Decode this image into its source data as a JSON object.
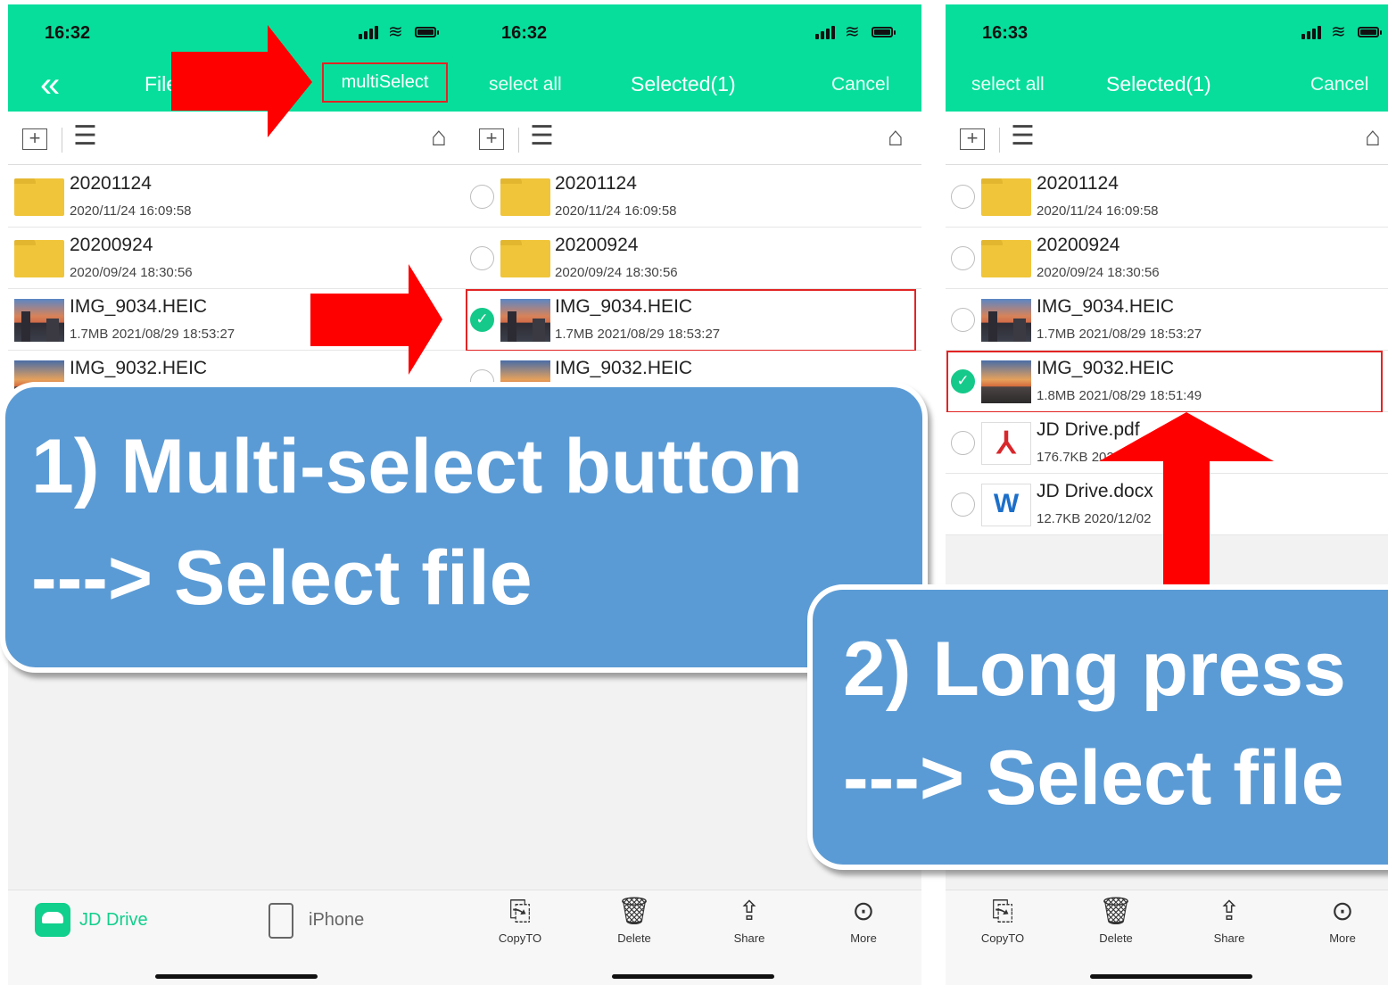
{
  "screens": [
    {
      "time": "16:32",
      "nav_title_partial": "File",
      "multiselect_label": "multiSelect",
      "files": [
        {
          "name": "20201124",
          "meta": "2020/11/24 16:09:58"
        },
        {
          "name": "20200924",
          "meta": "2020/09/24 18:30:56"
        },
        {
          "name": "IMG_9034.HEIC",
          "meta": "1.7MB 2021/08/29 18:53:27"
        },
        {
          "name": "IMG_9032.HEIC",
          "meta": ""
        }
      ],
      "tabs": [
        {
          "label": "JD Drive",
          "color": "#11cf8c"
        },
        {
          "label": "iPhone",
          "color": "#666666"
        }
      ]
    },
    {
      "time": "16:32",
      "select_all": "select all",
      "title": "Selected(1)",
      "cancel": "Cancel",
      "files": [
        {
          "name": "20201124",
          "meta": "2020/11/24 16:09:58",
          "checked": false
        },
        {
          "name": "20200924",
          "meta": "2020/09/24 18:30:56",
          "checked": false
        },
        {
          "name": "IMG_9034.HEIC",
          "meta": "1.7MB 2021/08/29 18:53:27",
          "checked": true
        },
        {
          "name": "IMG_9032.HEIC",
          "meta": "",
          "checked": false
        }
      ],
      "actions": [
        "CopyTO",
        "Delete",
        "Share",
        "More"
      ]
    },
    {
      "time": "16:33",
      "select_all": "select all",
      "title": "Selected(1)",
      "cancel": "Cancel",
      "files": [
        {
          "name": "20201124",
          "meta": "2020/11/24 16:09:58",
          "checked": false
        },
        {
          "name": "20200924",
          "meta": "2020/09/24 18:30:56",
          "checked": false
        },
        {
          "name": "IMG_9034.HEIC",
          "meta": "1.7MB 2021/08/29 18:53:27",
          "checked": false
        },
        {
          "name": "IMG_9032.HEIC",
          "meta": "1.8MB 2021/08/29 18:51:49",
          "checked": true
        },
        {
          "name": "JD Drive.pdf",
          "meta": "176.7KB 2020/12/0",
          "checked": false
        },
        {
          "name": "JD Drive.docx",
          "meta": "12.7KB 2020/12/02",
          "checked": false
        }
      ],
      "actions": [
        "CopyTO",
        "Delete",
        "Share",
        "More"
      ]
    }
  ],
  "callouts": {
    "first": {
      "line1": "1) Multi-select button",
      "line2": "---> Select file"
    },
    "second": {
      "line1": "2) Long press",
      "line2": "---> Select file"
    }
  },
  "colors": {
    "header_green": "#08de9c",
    "check_green": "#15c98a",
    "arrow_red": "#ff0000",
    "callout_blue": "#5b9bd5"
  },
  "icons": {
    "back": "double-chevron-left-icon",
    "new_folder": "new-folder-icon",
    "sort": "sort-list-icon",
    "home": "home-icon",
    "copy": "copy-icon",
    "delete": "trash-icon",
    "share": "share-icon",
    "more": "more-icon"
  }
}
